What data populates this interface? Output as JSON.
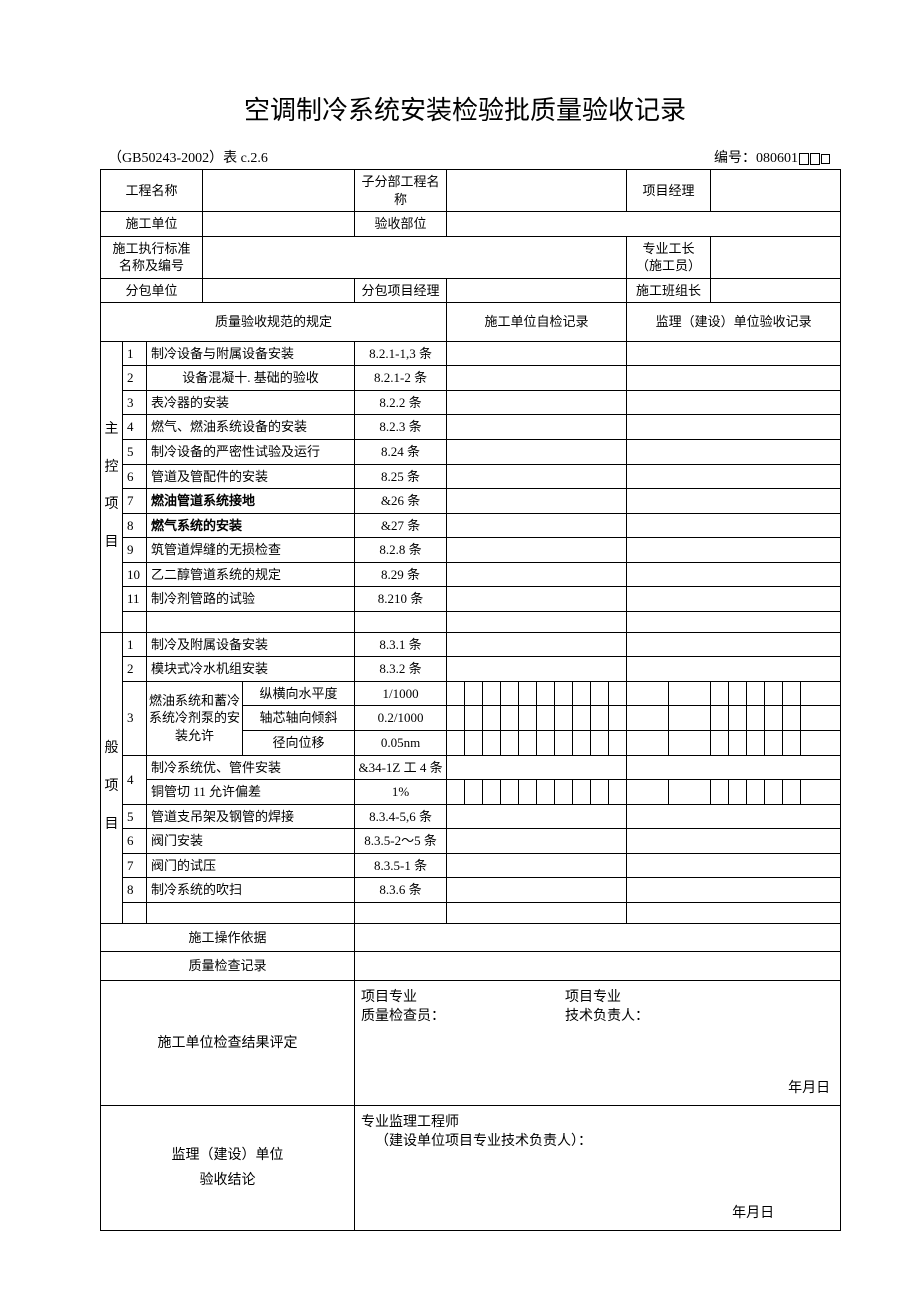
{
  "title": "空调制冷系统安装检验批质量验收记录",
  "meta_left": "（GB50243-2002）表 c.2.6",
  "meta_right_prefix": "编号：080601",
  "header": {
    "proj_name": "工程名称",
    "sub_proj_name": "子分部工程名称",
    "pm": "项目经理",
    "contractor": "施工单位",
    "accept_part": "验收部位",
    "std_name": "施工执行标准\n名称及编号",
    "foreman": "专业工长\n（施工员）",
    "subcontractor": "分包单位",
    "sub_pm": "分包项目经理",
    "team_leader": "施工班组长",
    "spec_rule": "质量验收规范的规定",
    "self_record": "施工单位自检记录",
    "sup_record": "监理（建设）单位验收记录"
  },
  "side_label_main": [
    "主",
    "控",
    "项",
    "目"
  ],
  "side_label_gen": [
    "般",
    "项",
    "目"
  ],
  "main_items": [
    {
      "n": "1",
      "desc": "制冷设备与附属设备安装",
      "ref": "8.2.1-1,3 条"
    },
    {
      "n": "2",
      "desc": "设备混凝十. 基础的验收",
      "ref": "8.2.1-2 条"
    },
    {
      "n": "3",
      "desc": "表冷器的安装",
      "ref": "8.2.2 条"
    },
    {
      "n": "4",
      "desc": "燃气、燃油系统设备的安装",
      "ref": "8.2.3 条"
    },
    {
      "n": "5",
      "desc": "制冷设备的严密性试验及运行",
      "ref": "8.24 条"
    },
    {
      "n": "6",
      "desc": "管道及管配件的安装",
      "ref": "8.25 条"
    },
    {
      "n": "7",
      "desc": "燃油管道系统接地",
      "ref": "&26 条",
      "bold": true
    },
    {
      "n": "8",
      "desc": "燃气系统的安装",
      "ref": "&27 条",
      "bold": true
    },
    {
      "n": "9",
      "desc": "筑管道焊缝的无损检查",
      "ref": "8.2.8 条"
    },
    {
      "n": "10",
      "desc": "乙二醇管道系统的规定",
      "ref": "8.29 条"
    },
    {
      "n": "11",
      "desc": "制冷剂管路的试验",
      "ref": "8.210 条"
    }
  ],
  "gen_items_a": [
    {
      "n": "1",
      "desc": "制冷及附属设备安装",
      "ref": "8.3.1 条"
    },
    {
      "n": "2",
      "desc": "模块式冷水机组安装",
      "ref": "8.3.2 条"
    }
  ],
  "gen_group3": {
    "n": "3",
    "group": "燃油系统和蓄冷系统冷剂泵的安装允许",
    "rows": [
      {
        "sub": "纵横向水平度",
        "ref": "1/1000"
      },
      {
        "sub": "轴芯轴向倾斜",
        "ref": "0.2/1000"
      },
      {
        "sub": "径向位移",
        "ref": "0.05nm"
      }
    ]
  },
  "gen_group4": {
    "n": "4",
    "rows": [
      {
        "desc": "制冷系统优、管件安装",
        "ref": "&34-1Z 工 4 条"
      },
      {
        "desc": "铜管切 11 允许偏差",
        "ref": "1%"
      }
    ]
  },
  "gen_items_b": [
    {
      "n": "5",
      "desc": "管道支吊架及钢管的焊接",
      "ref": "8.3.4-5,6 条"
    },
    {
      "n": "6",
      "desc": "阀门安装",
      "ref": "8.3.5-2～5 条"
    },
    {
      "n": "7",
      "desc": "阀门的试压",
      "ref": "8.3.5-1 条"
    },
    {
      "n": "8",
      "desc": "制冷系统的吹扫",
      "ref": "8.3.6 条"
    }
  ],
  "footer_rows": {
    "op_basis": "施工操作依据",
    "qc_record": "质量检查记录"
  },
  "sig1": {
    "left": "施工单位检查结果评定",
    "a": "项目专业",
    "a2": "质量检查员：",
    "b": "项目专业",
    "b2": "技术负责人：",
    "date": "年月日"
  },
  "sig2": {
    "left1": "监理（建设）单位",
    "left2": "验收结论",
    "a": "专业监理工程师",
    "a2": "（建设单位项目专业技术负责人）：",
    "date": "年月日"
  }
}
